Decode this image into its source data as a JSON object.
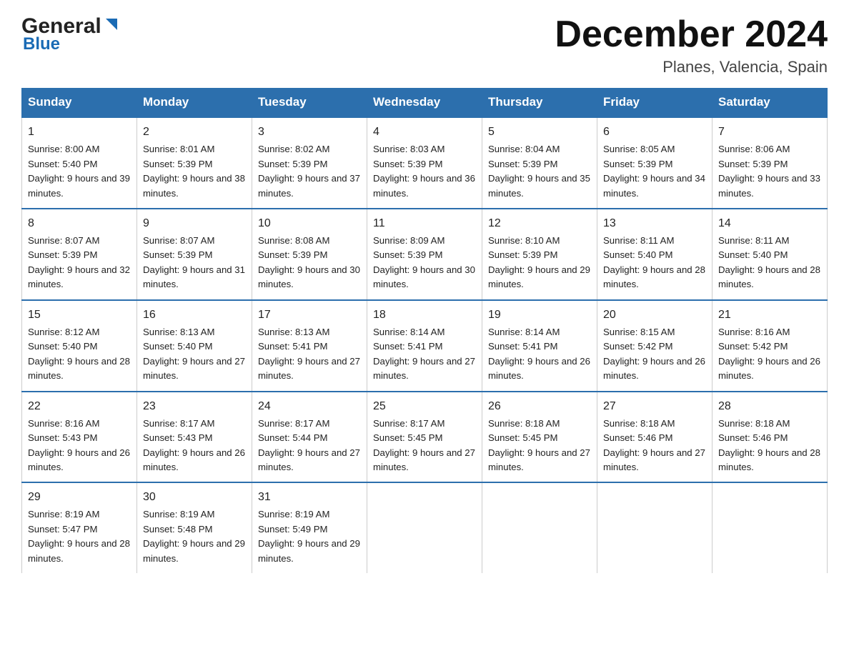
{
  "header": {
    "logo_general": "General",
    "logo_blue": "Blue",
    "month_title": "December 2024",
    "location": "Planes, Valencia, Spain"
  },
  "days_of_week": [
    "Sunday",
    "Monday",
    "Tuesday",
    "Wednesday",
    "Thursday",
    "Friday",
    "Saturday"
  ],
  "weeks": [
    [
      {
        "day": "1",
        "sunrise": "8:00 AM",
        "sunset": "5:40 PM",
        "daylight": "9 hours and 39 minutes."
      },
      {
        "day": "2",
        "sunrise": "8:01 AM",
        "sunset": "5:39 PM",
        "daylight": "9 hours and 38 minutes."
      },
      {
        "day": "3",
        "sunrise": "8:02 AM",
        "sunset": "5:39 PM",
        "daylight": "9 hours and 37 minutes."
      },
      {
        "day": "4",
        "sunrise": "8:03 AM",
        "sunset": "5:39 PM",
        "daylight": "9 hours and 36 minutes."
      },
      {
        "day": "5",
        "sunrise": "8:04 AM",
        "sunset": "5:39 PM",
        "daylight": "9 hours and 35 minutes."
      },
      {
        "day": "6",
        "sunrise": "8:05 AM",
        "sunset": "5:39 PM",
        "daylight": "9 hours and 34 minutes."
      },
      {
        "day": "7",
        "sunrise": "8:06 AM",
        "sunset": "5:39 PM",
        "daylight": "9 hours and 33 minutes."
      }
    ],
    [
      {
        "day": "8",
        "sunrise": "8:07 AM",
        "sunset": "5:39 PM",
        "daylight": "9 hours and 32 minutes."
      },
      {
        "day": "9",
        "sunrise": "8:07 AM",
        "sunset": "5:39 PM",
        "daylight": "9 hours and 31 minutes."
      },
      {
        "day": "10",
        "sunrise": "8:08 AM",
        "sunset": "5:39 PM",
        "daylight": "9 hours and 30 minutes."
      },
      {
        "day": "11",
        "sunrise": "8:09 AM",
        "sunset": "5:39 PM",
        "daylight": "9 hours and 30 minutes."
      },
      {
        "day": "12",
        "sunrise": "8:10 AM",
        "sunset": "5:39 PM",
        "daylight": "9 hours and 29 minutes."
      },
      {
        "day": "13",
        "sunrise": "8:11 AM",
        "sunset": "5:40 PM",
        "daylight": "9 hours and 28 minutes."
      },
      {
        "day": "14",
        "sunrise": "8:11 AM",
        "sunset": "5:40 PM",
        "daylight": "9 hours and 28 minutes."
      }
    ],
    [
      {
        "day": "15",
        "sunrise": "8:12 AM",
        "sunset": "5:40 PM",
        "daylight": "9 hours and 28 minutes."
      },
      {
        "day": "16",
        "sunrise": "8:13 AM",
        "sunset": "5:40 PM",
        "daylight": "9 hours and 27 minutes."
      },
      {
        "day": "17",
        "sunrise": "8:13 AM",
        "sunset": "5:41 PM",
        "daylight": "9 hours and 27 minutes."
      },
      {
        "day": "18",
        "sunrise": "8:14 AM",
        "sunset": "5:41 PM",
        "daylight": "9 hours and 27 minutes."
      },
      {
        "day": "19",
        "sunrise": "8:14 AM",
        "sunset": "5:41 PM",
        "daylight": "9 hours and 26 minutes."
      },
      {
        "day": "20",
        "sunrise": "8:15 AM",
        "sunset": "5:42 PM",
        "daylight": "9 hours and 26 minutes."
      },
      {
        "day": "21",
        "sunrise": "8:16 AM",
        "sunset": "5:42 PM",
        "daylight": "9 hours and 26 minutes."
      }
    ],
    [
      {
        "day": "22",
        "sunrise": "8:16 AM",
        "sunset": "5:43 PM",
        "daylight": "9 hours and 26 minutes."
      },
      {
        "day": "23",
        "sunrise": "8:17 AM",
        "sunset": "5:43 PM",
        "daylight": "9 hours and 26 minutes."
      },
      {
        "day": "24",
        "sunrise": "8:17 AM",
        "sunset": "5:44 PM",
        "daylight": "9 hours and 27 minutes."
      },
      {
        "day": "25",
        "sunrise": "8:17 AM",
        "sunset": "5:45 PM",
        "daylight": "9 hours and 27 minutes."
      },
      {
        "day": "26",
        "sunrise": "8:18 AM",
        "sunset": "5:45 PM",
        "daylight": "9 hours and 27 minutes."
      },
      {
        "day": "27",
        "sunrise": "8:18 AM",
        "sunset": "5:46 PM",
        "daylight": "9 hours and 27 minutes."
      },
      {
        "day": "28",
        "sunrise": "8:18 AM",
        "sunset": "5:46 PM",
        "daylight": "9 hours and 28 minutes."
      }
    ],
    [
      {
        "day": "29",
        "sunrise": "8:19 AM",
        "sunset": "5:47 PM",
        "daylight": "9 hours and 28 minutes."
      },
      {
        "day": "30",
        "sunrise": "8:19 AM",
        "sunset": "5:48 PM",
        "daylight": "9 hours and 29 minutes."
      },
      {
        "day": "31",
        "sunrise": "8:19 AM",
        "sunset": "5:49 PM",
        "daylight": "9 hours and 29 minutes."
      },
      null,
      null,
      null,
      null
    ]
  ]
}
